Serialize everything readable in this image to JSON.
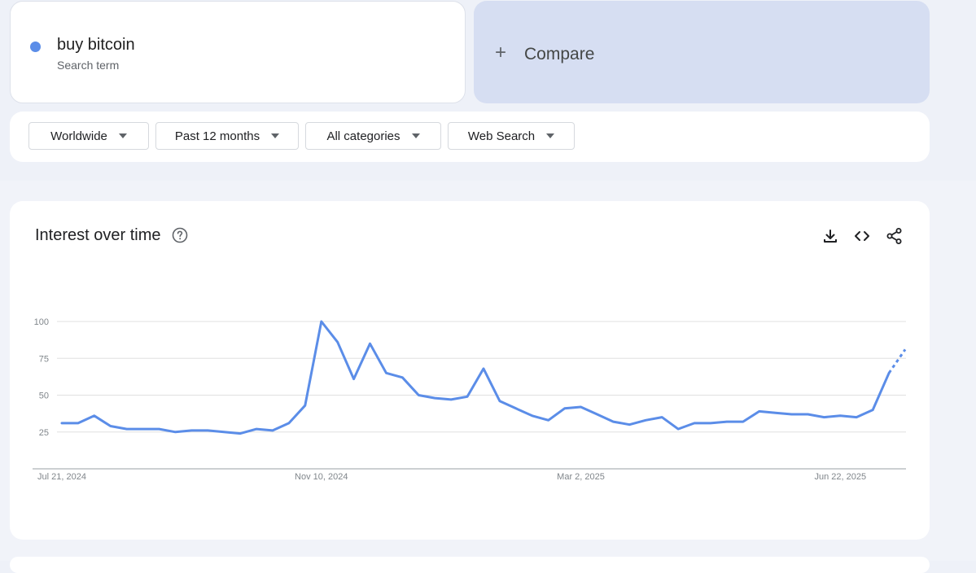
{
  "search_term": {
    "name": "buy bitcoin",
    "type": "Search term",
    "color": "#5b8de8"
  },
  "compare": {
    "label": "Compare",
    "icon": "plus-icon"
  },
  "filters": {
    "region": "Worldwide",
    "period": "Past 12 months",
    "category": "All categories",
    "search_type": "Web Search"
  },
  "interest_over_time": {
    "title": "Interest over time",
    "tools": [
      "download-icon",
      "embed-code-icon",
      "share-icon"
    ]
  },
  "chart_data": {
    "type": "line",
    "title": "",
    "xlabel": "",
    "ylabel": "",
    "ylim": [
      0,
      100
    ],
    "yticks": [
      25,
      50,
      75,
      100
    ],
    "xtick_labels": [
      "Jul 21, 2024",
      "Nov 10, 2024",
      "Mar 2, 2025",
      "Jun 22, 2025"
    ],
    "xtick_indices": [
      0,
      16,
      32,
      48
    ],
    "grid": true,
    "color": "#5b8de8",
    "series": [
      {
        "name": "buy bitcoin",
        "values": [
          31,
          31,
          36,
          29,
          27,
          27,
          27,
          25,
          26,
          26,
          25,
          24,
          27,
          26,
          31,
          43,
          100,
          86,
          61,
          85,
          65,
          62,
          50,
          48,
          47,
          49,
          68,
          46,
          41,
          36,
          33,
          41,
          42,
          37,
          32,
          30,
          33,
          35,
          27,
          31,
          31,
          32,
          32,
          39,
          38,
          37,
          37,
          35,
          36,
          35,
          40,
          65,
          81
        ],
        "partial_from_index": 51
      }
    ]
  }
}
